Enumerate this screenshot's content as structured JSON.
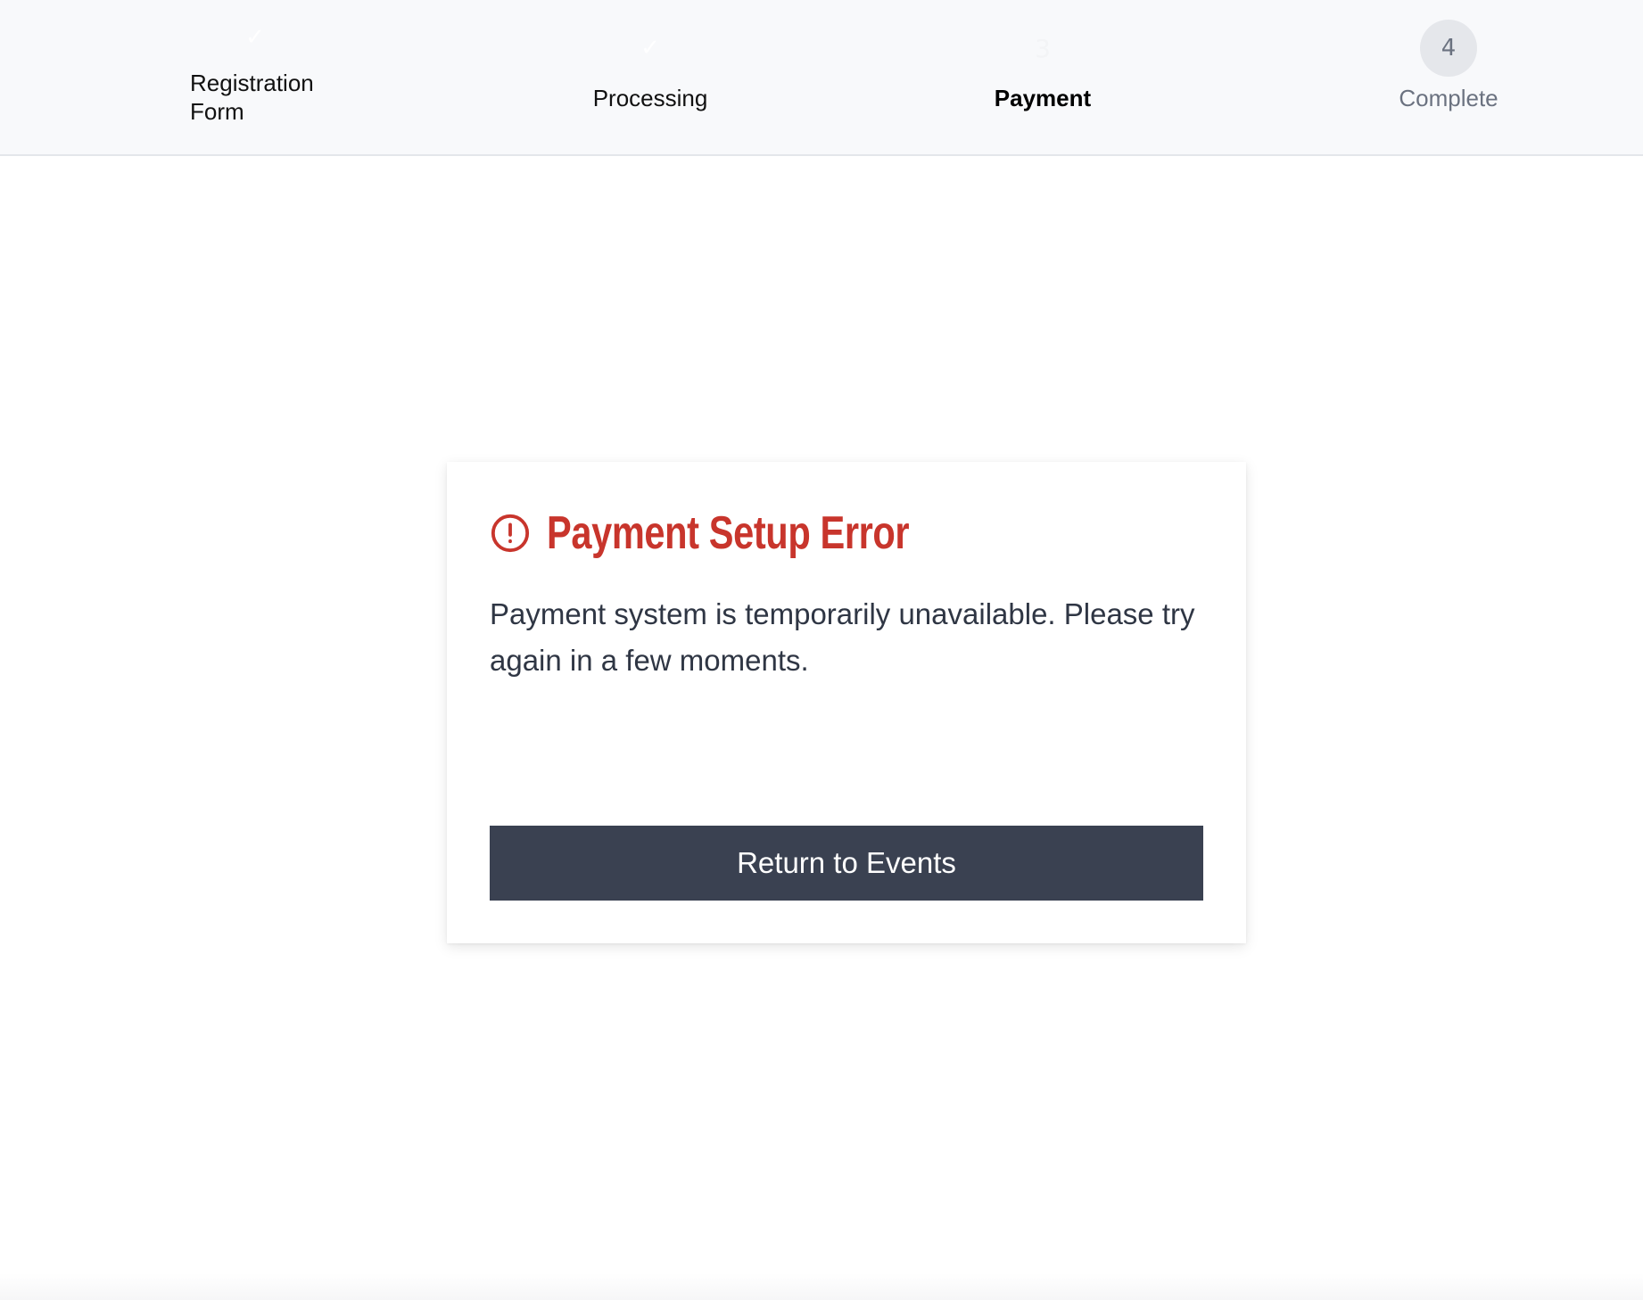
{
  "stepper": {
    "steps": [
      {
        "marker": "✓",
        "label": "Registration Form",
        "state": "done"
      },
      {
        "marker": "✓",
        "label": "Processing",
        "state": "done"
      },
      {
        "marker": "3",
        "label": "Payment",
        "state": "current"
      },
      {
        "marker": "4",
        "label": "Complete",
        "state": "pending"
      }
    ]
  },
  "error_card": {
    "icon": "alert-circle-icon",
    "title": "Payment Setup Error",
    "message": "Payment system is temporarily unavailable. Please try again in a few moments.",
    "button_label": "Return to Events"
  },
  "colors": {
    "error": "#c8352c",
    "button_bg": "#3a4151",
    "header_bg": "#f8f9fb",
    "pending_marker_bg": "#e5e7eb"
  }
}
